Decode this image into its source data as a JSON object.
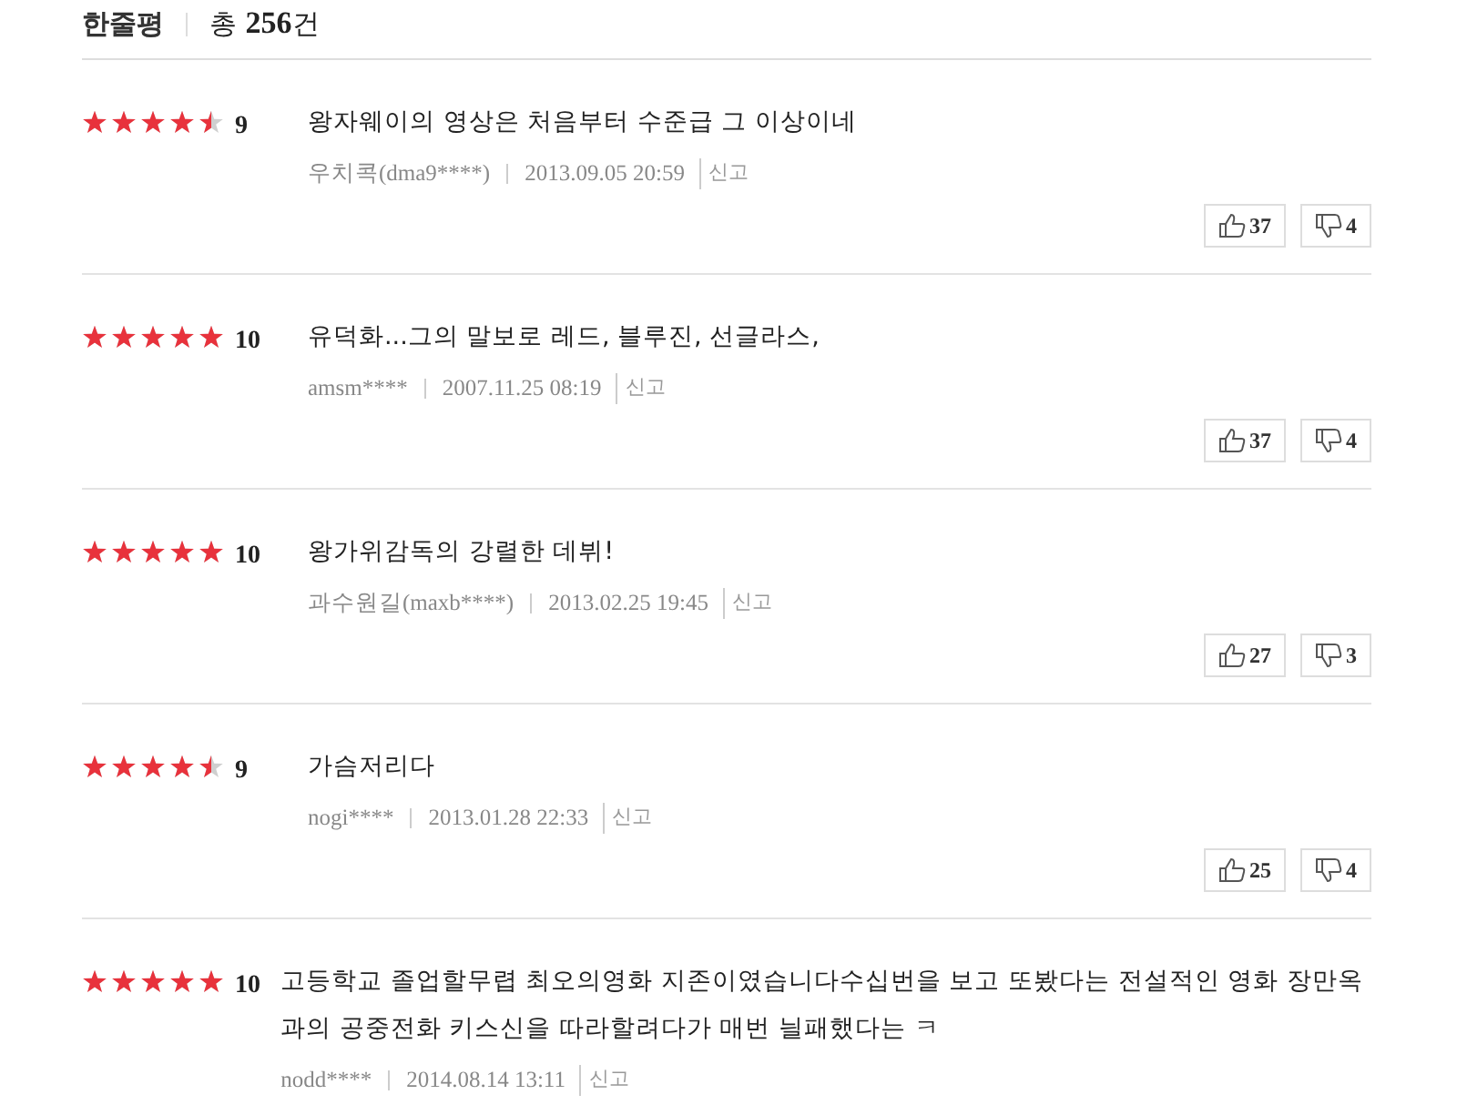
{
  "header": {
    "title": "한줄평",
    "total_prefix": "총",
    "total_count": "256",
    "total_suffix": "건"
  },
  "reviews": [
    {
      "stars": 4.5,
      "score": "9",
      "text": "왕자웨이의 영상은 처음부터 수준급 그 이상이네",
      "user_name": "우치콕",
      "user_id": "(dma9****)",
      "date": "2013.09.05 20:59",
      "report": "신고",
      "likes": "37",
      "dislikes": "4"
    },
    {
      "stars": 5,
      "score": "10",
      "text": "유덕화...그의 말보로 레드, 블루진, 선글라스,",
      "user_name": "amsm****",
      "date": "2007.11.25 08:19",
      "report": "신고",
      "likes": "37",
      "dislikes": "4"
    },
    {
      "stars": 5,
      "score": "10",
      "text": "왕가위감독의 강렬한 데뷔!",
      "user_name": "과수원길",
      "user_id": "(maxb****)",
      "date": "2013.02.25 19:45",
      "report": "신고",
      "likes": "27",
      "dislikes": "3"
    },
    {
      "stars": 4.5,
      "score": "9",
      "text": "가슴저리다",
      "user_name": "nogi****",
      "date": "2013.01.28 22:33",
      "report": "신고",
      "likes": "25",
      "dislikes": "4"
    },
    {
      "stars": 5,
      "score": "10",
      "text": "고등학교 졸업할무렵 최오의영화 지존이였습니다수십번을 보고 또봤다는 전설적인 영화 장만옥과의 공중전화 키스신을 따라할려다가 매번 늴패했다는 ㅋ",
      "user_name": "nodd****",
      "date": "2014.08.14 13:11",
      "report": "신고"
    }
  ]
}
